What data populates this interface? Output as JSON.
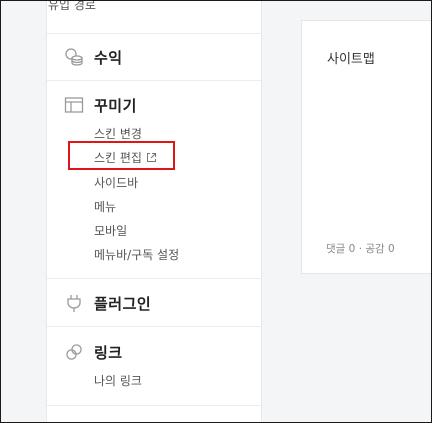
{
  "sidebar": {
    "top_item": "유입 경로",
    "sections": {
      "revenue": {
        "title": "수익",
        "icon": "coins-icon"
      },
      "design": {
        "title": "꾸미기",
        "icon": "layout-icon",
        "items": [
          "스킨 변경",
          "스킨 편집",
          "사이드바",
          "메뉴",
          "모바일",
          "메뉴바/구독 설정"
        ]
      },
      "plugin": {
        "title": "플러그인",
        "icon": "plug-icon"
      },
      "link": {
        "title": "링크",
        "icon": "link-icon",
        "items": [
          "나의 링크"
        ]
      }
    }
  },
  "card": {
    "title": "사이트맵",
    "comments_label": "댓글 0",
    "dot": "·",
    "likes_label": "공감 0"
  },
  "colors": {
    "highlight_border": "#e0151a",
    "background": "#f4f5f7"
  }
}
